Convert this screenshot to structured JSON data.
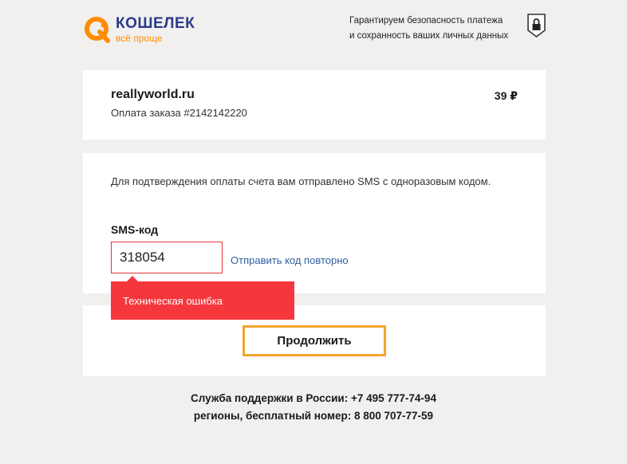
{
  "header": {
    "logo_title": "КОШЕЛЕК",
    "logo_subtitle": "всё проще",
    "guarantee_line1": "Гарантируем безопасность платежа",
    "guarantee_line2": "и сохранность ваших личных данных"
  },
  "order": {
    "merchant": "reallyworld.ru",
    "description": "Оплата заказа #2142142220",
    "amount": "39 ₽"
  },
  "sms": {
    "info": "Для подтверждения оплаты счета вам отправлено SMS с одноразовым кодом.",
    "label": "SMS-код",
    "value": "318054",
    "resend_label": "Отправить код повторно",
    "error": "Техническая ошибка"
  },
  "actions": {
    "continue_label": "Продолжить"
  },
  "support": {
    "line1": "Служба поддержки в России: +7 495 777-74-94",
    "line2": "регионы, бесплатный номер: 8 800 707-77-59"
  },
  "colors": {
    "brand_orange": "#ff8c00",
    "brand_blue": "#2b3a8a",
    "error_red": "#f4373d",
    "button_border": "#f6a430",
    "link": "#2e5f9f",
    "background": "#f1f0ef"
  },
  "icons": [
    "qiwi-logo-icon",
    "lock-shield-icon"
  ]
}
